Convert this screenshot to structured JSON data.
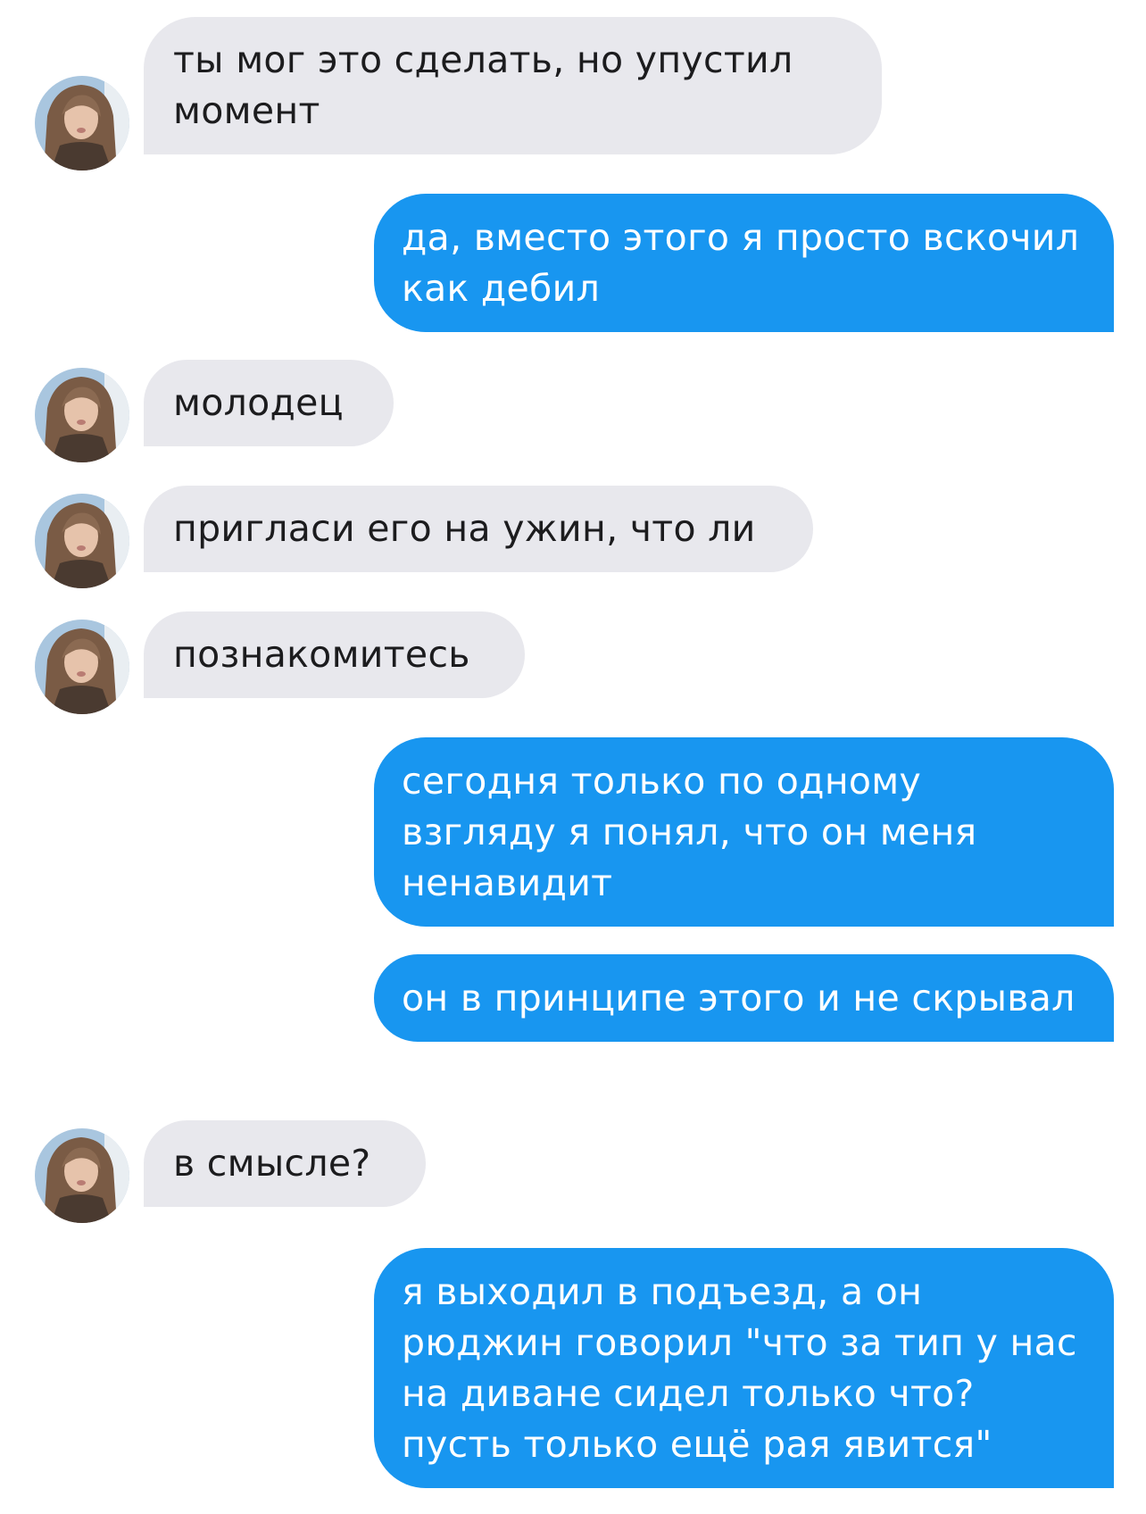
{
  "conversation": {
    "messages": [
      {
        "direction": "incoming",
        "text": "ты мог это сделать, но упустил момент",
        "avatar": "contact-avatar-photo"
      },
      {
        "direction": "outgoing",
        "text": "да, вместо этого я просто вскочил как дебил"
      },
      {
        "direction": "incoming",
        "text": "молодец",
        "avatar": "contact-avatar-photo"
      },
      {
        "direction": "incoming",
        "text": "пригласи его на ужин, что ли",
        "avatar": "contact-avatar-photo"
      },
      {
        "direction": "incoming",
        "text": "познакомитесь",
        "avatar": "contact-avatar-photo"
      },
      {
        "direction": "outgoing",
        "text": "сегодня только по одному взгляду я понял, что он меня ненавидит"
      },
      {
        "direction": "outgoing",
        "text": "он в принципе этого и не скрывал"
      },
      {
        "direction": "incoming",
        "text": "в смысле?",
        "avatar": "contact-avatar-photo"
      },
      {
        "direction": "outgoing",
        "text": "я выходил в подъезд, а он рюджин говорил \"что за тип у нас на диване сидел только что? пусть только ещё рая явится\""
      }
    ]
  },
  "colors": {
    "incoming_bubble": "#e8e8ed",
    "incoming_text": "#1c1c1e",
    "outgoing_bubble": "#1896f0",
    "outgoing_text": "#ffffff",
    "background": "#ffffff"
  }
}
